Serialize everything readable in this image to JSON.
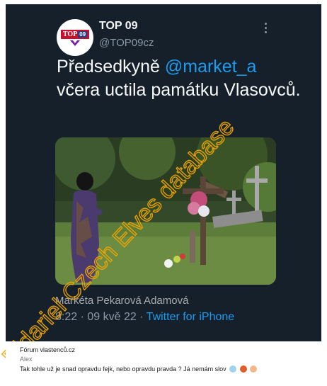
{
  "tweet": {
    "display_name": "TOP 09",
    "handle": "@TOP09cz",
    "avatar_logo_text": "TOP",
    "avatar_logo_number": "09",
    "text_prefix": "Předsedkyně ",
    "mention": "@market_a",
    "text_suffix": " včera uctila památku Vlasovců.",
    "photo_caption": "Markéta Pekarová Adamová",
    "time": "8:22 · 09 kvě 22 · ",
    "app": "Twitter for iPhone",
    "colors": {
      "background": "#15202b",
      "link": "#1d9bf0",
      "secondary_text": "#8b98a5"
    }
  },
  "watermark": {
    "text": "Eldariel Czech Elves database",
    "color": "#f0a500"
  },
  "forum_post": {
    "forum_name": "Fórum vlastenců.cz",
    "author": "Alex",
    "message": "Tak tohle už je snad opravdu fejk, nebo opravdu pravda ? Já nemám slov",
    "emoji_icons": [
      "screaming-face-icon",
      "angry-face-icon",
      "facepalm-icon"
    ]
  }
}
